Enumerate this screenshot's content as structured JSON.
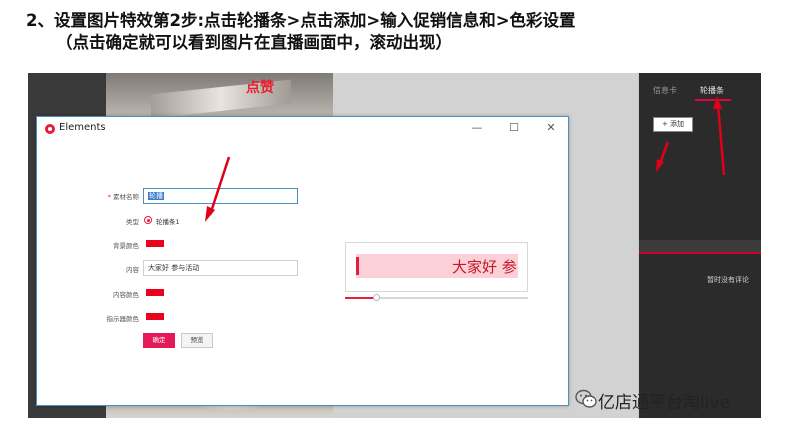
{
  "heading": {
    "line1": "2、设置图片特效第2步:点击轮播条>点击添加>输入促销信息和>色彩设置",
    "line2": "（点击确定就可以看到图片在直播画面中，滚动出现）"
  },
  "background": {
    "red_tag": "点赞"
  },
  "live_panel": {
    "tabs": [
      {
        "label": "信息卡"
      },
      {
        "label": "轮播条"
      }
    ],
    "add_button": "+ 添加",
    "no_comment": "暂时没有评论"
  },
  "dialog": {
    "title": "Elements",
    "controls": {
      "minimize": "—",
      "maximize": "☐",
      "close": "✕"
    },
    "form": {
      "name_label": "素材名称",
      "name_value": "轮播",
      "type_label": "类型",
      "type_option": "轮播条1",
      "bg_color_label": "背景颜色",
      "content_label": "内容",
      "content_value": "大家好 参与活动",
      "content_color_label": "内容颜色",
      "indicator_color_label": "指示器颜色"
    },
    "buttons": {
      "confirm": "确定",
      "preview": "预览"
    },
    "preview_text": "大家好 参",
    "scroll_progress": 0.17
  },
  "colors": {
    "accent": "#e21f3c",
    "bg_swatch": "#e8001f",
    "content_swatch": "#e8001f",
    "indicator_swatch": "#e8001f",
    "confirm_button": "#e5195a",
    "preview_text": "#c2182b",
    "live_bg": "#2b2b2b"
  },
  "watermark": {
    "text": "亿店通平台淘live",
    "icon": "wechat-icon"
  }
}
